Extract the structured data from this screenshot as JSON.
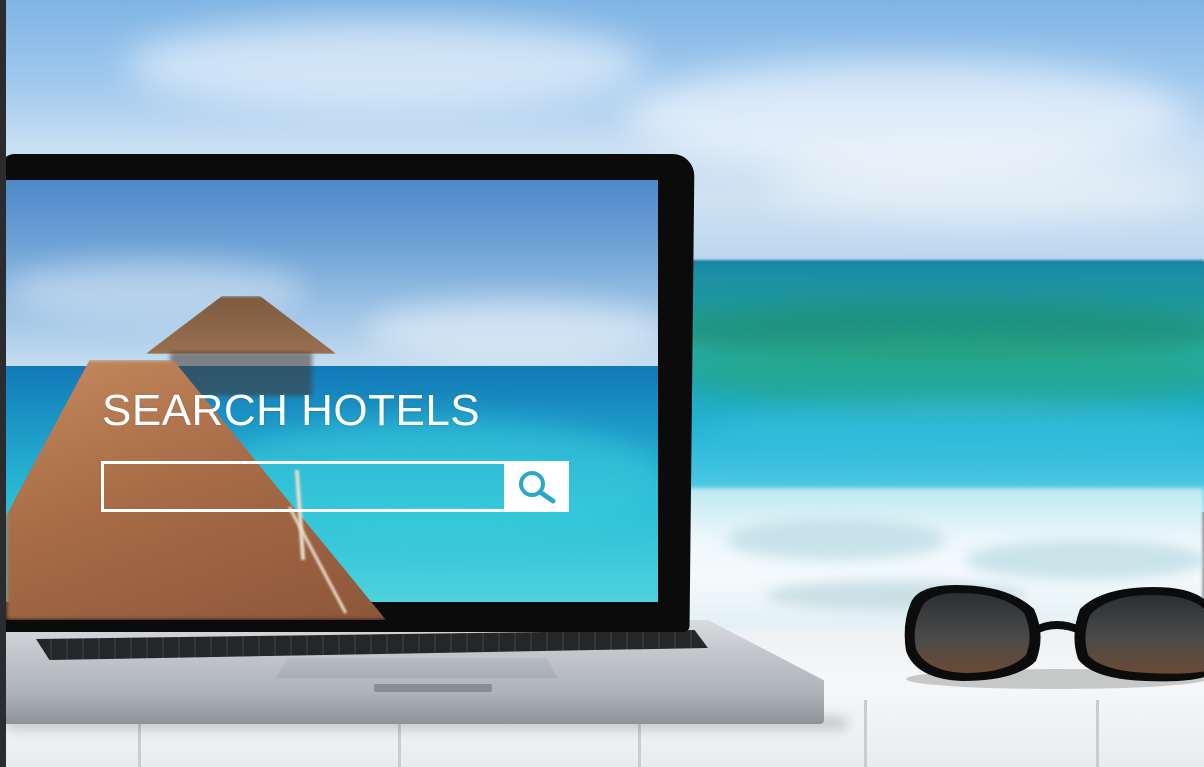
{
  "scene": {
    "description_kind": "stock-photo",
    "screen": {
      "title": "SEARCH HOTELS",
      "search": {
        "value": "",
        "placeholder": ""
      },
      "search_icon": "magnifier-icon",
      "accent_color": "#2aa7c9"
    }
  }
}
